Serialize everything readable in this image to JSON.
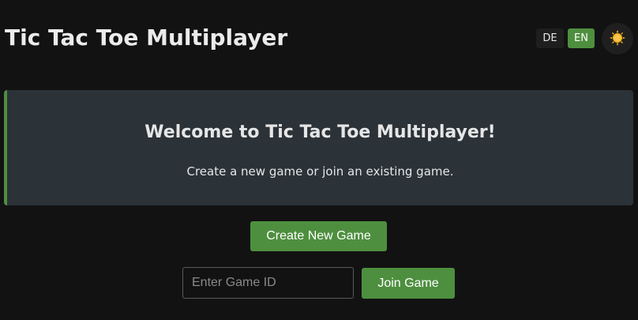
{
  "header": {
    "title": "Tic Tac Toe Multiplayer",
    "languages": [
      {
        "code": "DE",
        "active": false
      },
      {
        "code": "EN",
        "active": true
      }
    ],
    "theme_toggle_icon": "sun-icon"
  },
  "welcome": {
    "title": "Welcome to Tic Tac Toe Multiplayer!",
    "text": "Create a new game or join an existing game."
  },
  "actions": {
    "create_label": "Create New Game",
    "game_id_placeholder": "Enter Game ID",
    "game_id_value": "",
    "join_label": "Join Game"
  },
  "colors": {
    "accent": "#4e8f3f",
    "background": "#121212",
    "panel": "#2b3238",
    "sun": "#f4b323"
  }
}
